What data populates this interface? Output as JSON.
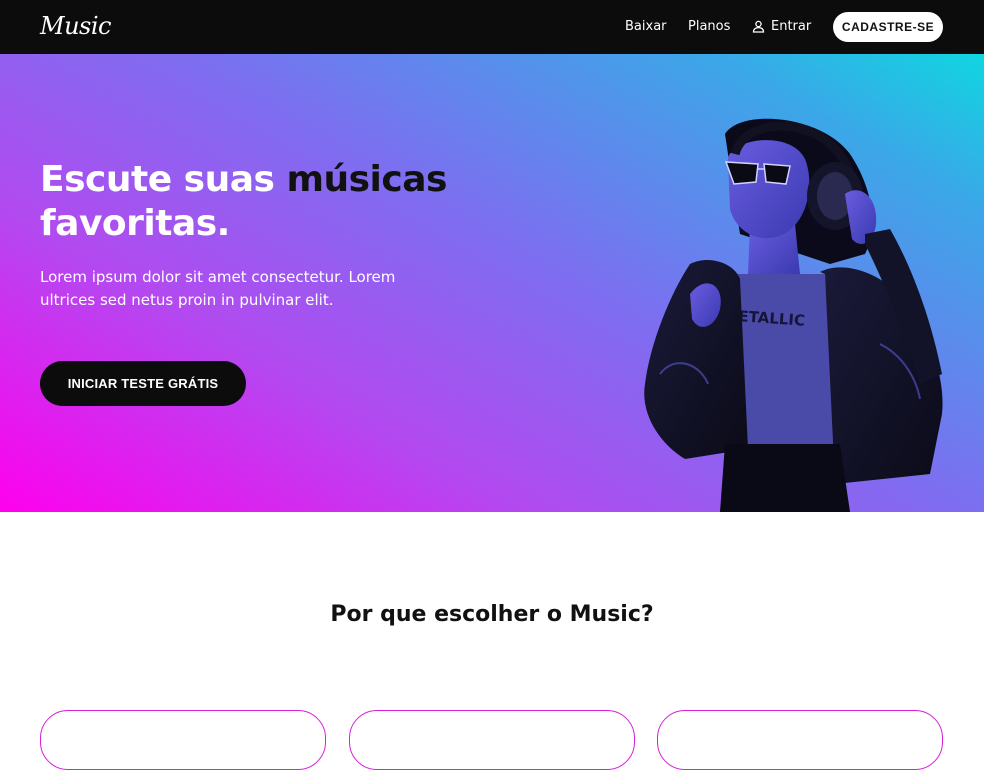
{
  "header": {
    "logo": "Music",
    "nav": [
      {
        "label": "Baixar"
      },
      {
        "label": "Planos"
      },
      {
        "label": "Entrar",
        "icon": "user-icon"
      }
    ],
    "signup_label": "CADASTRE-SE"
  },
  "hero": {
    "title_part1": "Escute suas ",
    "title_accent": "músicas",
    "title_part2": "favoritas.",
    "subtitle": "Lorem ipsum dolor sit amet consectetur. Lorem ultrices sed netus proin in pulvinar elit.",
    "cta_label": "INICIAR TESTE GRÁTIS",
    "image": "woman-with-headphones-photo"
  },
  "why": {
    "title": "Por que escolher o Music?"
  },
  "colors": {
    "header_bg": "#0c0c0c",
    "gradient_start": "#ff00ee",
    "gradient_end": "#10d6e0",
    "card_border": "#d81fd8"
  }
}
